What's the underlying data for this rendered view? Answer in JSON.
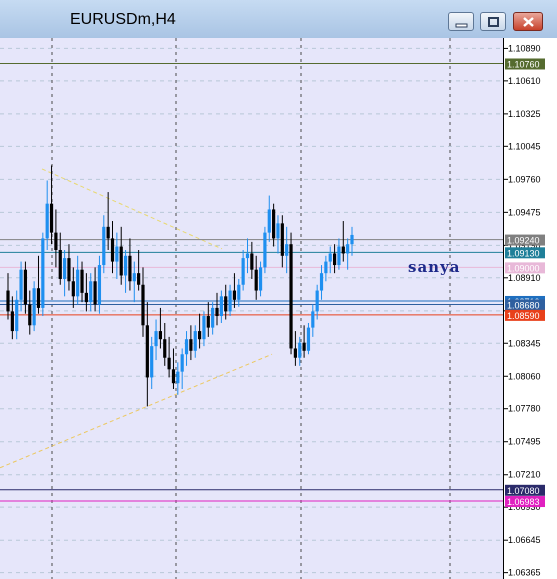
{
  "window": {
    "title": "EURUSDm,H4"
  },
  "watermark": "sanya",
  "colors": {
    "bull": "#1e8ff0",
    "bear": "#000000",
    "background": "#e6e6fa"
  },
  "chart_data": {
    "type": "candlestick",
    "symbol": "EURUSDm",
    "timeframe": "H4",
    "ylim": [
      1.0631,
      1.1098
    ],
    "price_ticks": [
      "1.10890",
      "1.10610",
      "1.10325",
      "1.10045",
      "1.09760",
      "1.09475",
      "1.09190",
      "1.08910",
      "1.08625",
      "1.08345",
      "1.08060",
      "1.07780",
      "1.07495",
      "1.07210",
      "1.06930",
      "1.06645",
      "1.06365"
    ],
    "levels": [
      {
        "price": 1.1076,
        "label": "1.10760",
        "color": "#556b2f"
      },
      {
        "price": 1.0924,
        "label": "1.09240",
        "color": "#808080"
      },
      {
        "price": 1.0913,
        "label": "1.09130",
        "color": "#1f7f99"
      },
      {
        "price": 1.09,
        "label": "1.09000",
        "color": "#e8b8d8"
      },
      {
        "price": 1.0871,
        "label": "1.08710",
        "color": "#1f6fbf"
      },
      {
        "price": 1.0868,
        "label": "1.08680",
        "color": "#2f5f9f"
      },
      {
        "price": 1.0859,
        "label": "1.08590",
        "color": "#e8401a"
      },
      {
        "price": 1.0708,
        "label": "1.07080",
        "color": "#2a2a6a"
      },
      {
        "price": 1.06983,
        "label": "1.06983",
        "color": "#e020c0"
      }
    ],
    "trendlines": [
      {
        "from": [
          42,
          1.0985
        ],
        "to": [
          222,
          1.0916
        ],
        "color": "#e8d870"
      },
      {
        "from": [
          0,
          1.0727
        ],
        "to": [
          272,
          1.0825
        ],
        "color": "#ecc860"
      }
    ],
    "candles": [
      [
        1.088,
        1.0895,
        1.0855,
        1.0862
      ],
      [
        1.0862,
        1.0875,
        1.0838,
        1.0845
      ],
      [
        1.0845,
        1.088,
        1.0838,
        1.0872
      ],
      [
        1.0872,
        1.0905,
        1.0862,
        1.0898
      ],
      [
        1.0898,
        1.0905,
        1.086,
        1.0868
      ],
      [
        1.0868,
        1.088,
        1.0842,
        1.085
      ],
      [
        1.085,
        1.0888,
        1.0845,
        1.0882
      ],
      [
        1.0882,
        1.091,
        1.086,
        1.0865
      ],
      [
        1.0865,
        1.093,
        1.0858,
        1.0925
      ],
      [
        1.0925,
        1.0975,
        1.0915,
        1.0955
      ],
      [
        1.0955,
        1.0988,
        1.092,
        1.093
      ],
      [
        1.093,
        1.095,
        1.09,
        1.0915
      ],
      [
        1.0915,
        1.093,
        1.0885,
        1.089
      ],
      [
        1.089,
        1.0915,
        1.0875,
        1.0908
      ],
      [
        1.0908,
        1.092,
        1.088,
        1.0888
      ],
      [
        1.0888,
        1.09,
        1.0865,
        1.0875
      ],
      [
        1.0875,
        1.091,
        1.0868,
        1.0898
      ],
      [
        1.0898,
        1.0905,
        1.087,
        1.0878
      ],
      [
        1.0878,
        1.0895,
        1.0862,
        1.087
      ],
      [
        1.087,
        1.0895,
        1.0862,
        1.0888
      ],
      [
        1.0888,
        1.09,
        1.0862,
        1.0868
      ],
      [
        1.0868,
        1.091,
        1.086,
        1.0902
      ],
      [
        1.0902,
        1.0945,
        1.0895,
        1.0935
      ],
      [
        1.0935,
        1.0965,
        1.0915,
        1.0925
      ],
      [
        1.0925,
        1.094,
        1.0895,
        1.0905
      ],
      [
        1.0905,
        1.093,
        1.089,
        1.0918
      ],
      [
        1.0918,
        1.0935,
        1.0885,
        1.0893
      ],
      [
        1.0893,
        1.0915,
        1.0878,
        1.091
      ],
      [
        1.091,
        1.0925,
        1.088,
        1.0888
      ],
      [
        1.0888,
        1.0905,
        1.087,
        1.0895
      ],
      [
        1.0895,
        1.0915,
        1.088,
        1.0885
      ],
      [
        1.0885,
        1.09,
        1.084,
        1.085
      ],
      [
        1.085,
        1.087,
        1.078,
        1.0805
      ],
      [
        1.0805,
        1.084,
        1.0795,
        1.0832
      ],
      [
        1.0832,
        1.0855,
        1.082,
        1.0845
      ],
      [
        1.0845,
        1.0865,
        1.083,
        1.0838
      ],
      [
        1.0838,
        1.0852,
        1.0815,
        1.0822
      ],
      [
        1.0822,
        1.084,
        1.0805,
        1.0812
      ],
      [
        1.0812,
        1.083,
        1.0795,
        1.08
      ],
      [
        1.08,
        1.0818,
        1.079,
        1.081
      ],
      [
        1.081,
        1.083,
        1.0795,
        1.0825
      ],
      [
        1.0825,
        1.0845,
        1.0815,
        1.0838
      ],
      [
        1.0838,
        1.085,
        1.082,
        1.0828
      ],
      [
        1.0828,
        1.085,
        1.0822,
        1.0845
      ],
      [
        1.0845,
        1.086,
        1.083,
        1.0838
      ],
      [
        1.0838,
        1.0862,
        1.0832,
        1.0858
      ],
      [
        1.0858,
        1.087,
        1.084,
        1.0848
      ],
      [
        1.0848,
        1.087,
        1.0842,
        1.0865
      ],
      [
        1.0865,
        1.0878,
        1.085,
        1.0858
      ],
      [
        1.0858,
        1.088,
        1.0852,
        1.0875
      ],
      [
        1.0875,
        1.0885,
        1.0855,
        1.0862
      ],
      [
        1.0862,
        1.0885,
        1.0858,
        1.088
      ],
      [
        1.088,
        1.0895,
        1.0865,
        1.0872
      ],
      [
        1.0872,
        1.089,
        1.0866,
        1.0885
      ],
      [
        1.0885,
        1.0915,
        1.088,
        1.0908
      ],
      [
        1.0908,
        1.0925,
        1.0895,
        1.0912
      ],
      [
        1.0912,
        1.0922,
        1.089,
        1.0898
      ],
      [
        1.0898,
        1.091,
        1.0872,
        1.088
      ],
      [
        1.088,
        1.0905,
        1.0875,
        1.09
      ],
      [
        1.09,
        1.0935,
        1.0895,
        1.093
      ],
      [
        1.093,
        1.0962,
        1.0922,
        1.095
      ],
      [
        1.095,
        1.0955,
        1.0918,
        1.0925
      ],
      [
        1.0925,
        1.0945,
        1.0912,
        1.0938
      ],
      [
        1.0938,
        1.0945,
        1.09,
        1.091
      ],
      [
        1.091,
        1.0935,
        1.0895,
        1.092
      ],
      [
        1.092,
        1.093,
        1.0825,
        1.083
      ],
      [
        1.083,
        1.0845,
        1.0815,
        1.0822
      ],
      [
        1.0822,
        1.084,
        1.0815,
        1.0835
      ],
      [
        1.0835,
        1.085,
        1.0822,
        1.0828
      ],
      [
        1.0828,
        1.0852,
        1.0825,
        1.0848
      ],
      [
        1.0848,
        1.0868,
        1.084,
        1.0862
      ],
      [
        1.0862,
        1.0885,
        1.0855,
        1.088
      ],
      [
        1.088,
        1.0902,
        1.0872,
        1.0895
      ],
      [
        1.0895,
        1.091,
        1.0888,
        1.0905
      ],
      [
        1.0905,
        1.0918,
        1.0895,
        1.0912
      ],
      [
        1.0912,
        1.092,
        1.0895,
        1.0902
      ],
      [
        1.0902,
        1.0925,
        1.0898,
        1.0918
      ],
      [
        1.0918,
        1.094,
        1.0905,
        1.0912
      ],
      [
        1.0912,
        1.0925,
        1.0898,
        1.092
      ],
      [
        1.092,
        1.0935,
        1.091,
        1.0928
      ]
    ]
  }
}
